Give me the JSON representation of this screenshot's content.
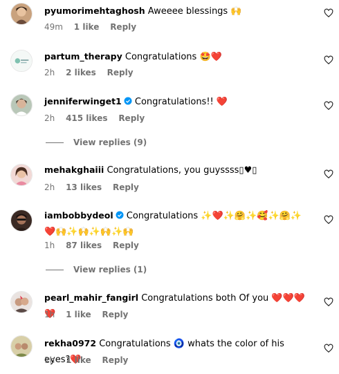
{
  "comments": [
    {
      "user": "pyumorimehtaghosh",
      "text": "Aweeee blessings",
      "emoji": "🙌",
      "time": "49m",
      "likes": "1 like",
      "reply": "Reply",
      "verified": false
    },
    {
      "user": "partum_therapy",
      "text": "Congratulations",
      "emoji": "🤩❤️",
      "time": "2h",
      "likes": "2 likes",
      "reply": "Reply",
      "verified": false
    },
    {
      "user": "jenniferwinget1",
      "text": "Congratulations!!",
      "emoji": "❤️",
      "time": "2h",
      "likes": "415 likes",
      "reply": "Reply",
      "verified": true
    },
    {
      "user": "mehakghaiii",
      "text": "Congratulations, you guyssss",
      "emoji": "▯♥▯",
      "time": "2h",
      "likes": "13 likes",
      "reply": "Reply",
      "verified": false
    },
    {
      "user": "iambobbydeol",
      "text": "Congratulations",
      "emoji": "✨❤️✨🤗✨🥰✨🤗✨",
      "emoji2": "❤️🙌✨🙌✨🙌✨🙌",
      "time": "1h",
      "likes": "87 likes",
      "reply": "Reply",
      "verified": true
    },
    {
      "user": "pearl_mahir_fangirl",
      "text": "Congratulations both Of you",
      "emoji": "❤️❤️❤️❤️",
      "time": "1h",
      "likes": "1 like",
      "reply": "Reply",
      "verified": false
    },
    {
      "user": "rekha0972",
      "text": "Congratulations",
      "emoji": "🧿",
      "text2": "whats the color of his eyes?",
      "emoji3": "❤️",
      "time": "1h",
      "likes": "1 like",
      "reply": "Reply",
      "verified": false
    }
  ],
  "view_replies": [
    {
      "label": "View replies (9)"
    },
    {
      "label": "View replies (1)"
    }
  ],
  "colors": {
    "heart": "#ed4956",
    "verified": "#0095f6",
    "meta": "#737373"
  }
}
